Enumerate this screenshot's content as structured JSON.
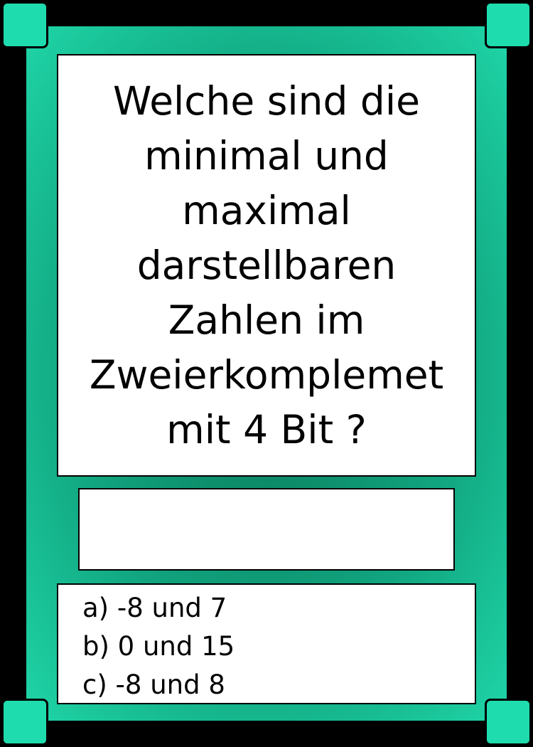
{
  "card": {
    "question": "Welche sind die minimal und maximal darstellbaren Zahlen im Zweierkomplemet mit 4 Bit ?",
    "options": [
      "a) -8 und 7",
      "b) 0 und 15",
      "c) -8 und 8"
    ],
    "answer": ""
  },
  "colors": {
    "frame_outer": "#1fd6a8",
    "frame_inner": "#0a7a5a",
    "corner": "#1fdcae",
    "background": "#000000",
    "panel": "#ffffff"
  }
}
